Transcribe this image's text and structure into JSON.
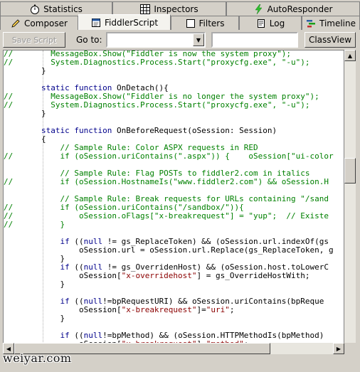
{
  "tabs_top": [
    {
      "label": "Statistics",
      "icon": "stopwatch-icon"
    },
    {
      "label": "Inspectors",
      "icon": "inspector-grid-icon"
    },
    {
      "label": "AutoResponder",
      "icon": "lightning-icon"
    }
  ],
  "tabs_bottom": [
    {
      "label": "Composer",
      "icon": "pencil-icon"
    },
    {
      "label": "FiddlerScript",
      "icon": "script-icon",
      "active": true
    },
    {
      "label": "Filters",
      "icon": "checkbox-icon"
    },
    {
      "label": "Log",
      "icon": "log-icon"
    },
    {
      "label": "Timeline",
      "icon": "timeline-icon"
    }
  ],
  "toolbar": {
    "save_script": "Save Script",
    "goto_label": "Go to:",
    "goto_value": "",
    "search_value": "",
    "classview": "ClassView"
  },
  "watermark": "weiyar.com",
  "code_lines": [
    [
      [
        "//",
        "c"
      ],
      [
        "        MessageBox.Show(",
        "c"
      ],
      [
        "\"Fiddler is now the system proxy\"",
        "c"
      ],
      [
        ");",
        "c"
      ]
    ],
    [
      [
        "//",
        "c"
      ],
      [
        "        System.Diagnostics.Process.Start(",
        "c"
      ],
      [
        "\"proxycfg.exe\"",
        "c"
      ],
      [
        ", ",
        "c"
      ],
      [
        "\"-u\"",
        "c"
      ],
      [
        ");",
        "c"
      ]
    ],
    [
      [
        "        }",
        ""
      ]
    ],
    [
      [
        "",
        ""
      ]
    ],
    [
      [
        "        ",
        ""
      ],
      [
        "static function",
        "k"
      ],
      [
        " OnDetach(){",
        ""
      ]
    ],
    [
      [
        "//",
        "c"
      ],
      [
        "        MessageBox.Show(",
        "c"
      ],
      [
        "\"Fiddler is no longer the system proxy\"",
        "c"
      ],
      [
        ");",
        "c"
      ]
    ],
    [
      [
        "//",
        "c"
      ],
      [
        "        System.Diagnostics.Process.Start(",
        "c"
      ],
      [
        "\"proxycfg.exe\"",
        "c"
      ],
      [
        ", ",
        "c"
      ],
      [
        "\"-u\"",
        "c"
      ],
      [
        ");",
        "c"
      ]
    ],
    [
      [
        "        }",
        ""
      ]
    ],
    [
      [
        "",
        ""
      ]
    ],
    [
      [
        "        ",
        ""
      ],
      [
        "static function",
        "k"
      ],
      [
        " OnBeforeRequest(oSession: Session)",
        ""
      ]
    ],
    [
      [
        "        {",
        ""
      ]
    ],
    [
      [
        "            ",
        ""
      ],
      [
        "// Sample Rule: Color ASPX requests in RED",
        "c"
      ]
    ],
    [
      [
        "//",
        "c"
      ],
      [
        "          if (oSession.uriContains(\".aspx\")) {    oSession[\"ui-color",
        "c"
      ]
    ],
    [
      [
        "",
        ""
      ]
    ],
    [
      [
        "            ",
        ""
      ],
      [
        "// Sample Rule: Flag POSTs to fiddler2.com in italics",
        "c"
      ]
    ],
    [
      [
        "//",
        "c"
      ],
      [
        "          if (oSession.HostnameIs(\"www.fiddler2.com\") && oSession.H",
        "c"
      ]
    ],
    [
      [
        "",
        ""
      ]
    ],
    [
      [
        "            ",
        ""
      ],
      [
        "// Sample Rule: Break requests for URLs containing \"/sand",
        "c"
      ]
    ],
    [
      [
        "//",
        "c"
      ],
      [
        "          if (oSession.uriContains(\"/sandbox/\")){",
        "c"
      ]
    ],
    [
      [
        "//",
        "c"
      ],
      [
        "              oSession.oFlags[\"x-breakrequest\"] = \"yup\";  // Existe",
        "c"
      ]
    ],
    [
      [
        "//",
        "c"
      ],
      [
        "          }",
        "c"
      ]
    ],
    [
      [
        "",
        ""
      ]
    ],
    [
      [
        "            ",
        ""
      ],
      [
        "if",
        "k"
      ],
      [
        " ((",
        ""
      ],
      [
        "null",
        "k"
      ],
      [
        " != gs_ReplaceToken) && (oSession.url.indexOf(gs",
        ""
      ]
    ],
    [
      [
        "                oSession.url = oSession.url.Replace(gs_ReplaceToken, g",
        ""
      ]
    ],
    [
      [
        "            }",
        ""
      ]
    ],
    [
      [
        "            ",
        ""
      ],
      [
        "if",
        "k"
      ],
      [
        " ((",
        ""
      ],
      [
        "null",
        "k"
      ],
      [
        " != gs_OverridenHost) && (oSession.host.toLowerC",
        ""
      ]
    ],
    [
      [
        "                oSession[",
        ""
      ],
      [
        "\"x-overridehost\"",
        "s"
      ],
      [
        "] = gs_OverrideHostWith;",
        ""
      ]
    ],
    [
      [
        "            }",
        ""
      ]
    ],
    [
      [
        "",
        ""
      ]
    ],
    [
      [
        "            ",
        ""
      ],
      [
        "if",
        "k"
      ],
      [
        " ((",
        ""
      ],
      [
        "null",
        "k"
      ],
      [
        "!=bpRequestURI) && oSession.uriContains(bpReque",
        ""
      ]
    ],
    [
      [
        "                oSession[",
        ""
      ],
      [
        "\"x-breakrequest\"",
        "s"
      ],
      [
        "]=",
        ""
      ],
      [
        "\"uri\"",
        "s"
      ],
      [
        ";",
        ""
      ]
    ],
    [
      [
        "            }",
        ""
      ]
    ],
    [
      [
        "",
        ""
      ]
    ],
    [
      [
        "            ",
        ""
      ],
      [
        "if",
        "k"
      ],
      [
        " ((",
        ""
      ],
      [
        "null",
        "k"
      ],
      [
        "!=bpMethod) && (oSession.HTTPMethodIs(bpMethod)",
        ""
      ]
    ],
    [
      [
        "                oSession[",
        ""
      ],
      [
        "\"x-breakrequest\"",
        "s"
      ],
      [
        "]=",
        ""
      ],
      [
        "\"method\"",
        "s"
      ],
      [
        ";",
        ""
      ]
    ],
    [
      [
        "            }",
        ""
      ]
    ]
  ]
}
